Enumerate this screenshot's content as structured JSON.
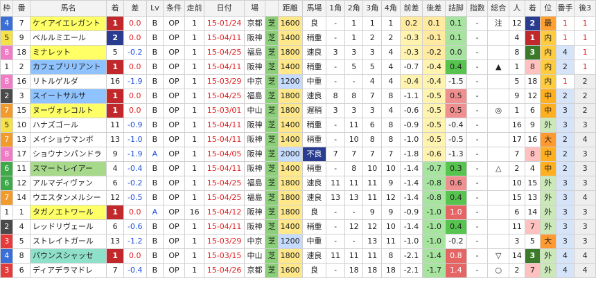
{
  "headers": [
    "枠",
    "番",
    "馬名",
    "着",
    "差",
    "Lv",
    "条件",
    "走前",
    "日付",
    "場",
    "",
    "距離",
    "馬場",
    "1角",
    "2角",
    "3角",
    "4角",
    "前差",
    "後差",
    "詰脚",
    "指数",
    "総合",
    "人",
    "着",
    "位",
    "番手",
    "後3"
  ],
  "rows": [
    {
      "gate": "4",
      "num": "7",
      "name": "ケイアイエレガント",
      "namecls": "nm-yellow",
      "fin": "1",
      "diff": "0.0",
      "lv": "B",
      "cls": "OP",
      "prev": "1",
      "date": "15-01/24",
      "track": "京都",
      "surf": "芝",
      "dist": "1600",
      "distcls": "dist",
      "cond": "良",
      "c1": "-",
      "c2": "1",
      "c3": "1",
      "c4": "1",
      "front": "0.2",
      "back": "0.1",
      "close": "0.1",
      "idx": "-",
      "total": "注",
      "pop": "12",
      "pfin": "2",
      "pos": "最",
      "ban": "1",
      "l3": "1"
    },
    {
      "gate": "5",
      "num": "9",
      "name": "ベルルミエール",
      "namecls": "",
      "fin": "2",
      "diff": "0.0",
      "lv": "B",
      "cls": "OP",
      "prev": "1",
      "date": "15-04/11",
      "track": "阪神",
      "surf": "芝",
      "dist": "1400",
      "distcls": "dist",
      "cond": "稍重",
      "c1": "-",
      "c2": "1",
      "c3": "2",
      "c4": "2",
      "front": "-0.3",
      "back": "-0.1",
      "close": "0.1",
      "idx": "-",
      "total": "",
      "pop": "4",
      "pfin": "1",
      "pos": "内",
      "ban": "1",
      "l3": "1"
    },
    {
      "gate": "8",
      "num": "18",
      "name": "ミナレット",
      "namecls": "nm-yellow",
      "fin": "5",
      "diff": "-0.2",
      "lv": "B",
      "cls": "OP",
      "prev": "1",
      "date": "15-04/25",
      "track": "福島",
      "surf": "芝",
      "dist": "1800",
      "distcls": "dist",
      "cond": "速良",
      "c1": "3",
      "c2": "3",
      "c3": "3",
      "c4": "4",
      "front": "-0.3",
      "back": "-0.2",
      "close": "0.0",
      "idx": "-",
      "total": "",
      "pop": "8",
      "pfin": "3",
      "pos": "内",
      "ban": "4",
      "l3": "1"
    },
    {
      "gate": "1",
      "num": "2",
      "name": "カフェブリリアント",
      "namecls": "nm-blue",
      "fin": "1",
      "diff": "0.0",
      "lv": "B",
      "cls": "OP",
      "prev": "1",
      "date": "15-04/11",
      "track": "阪神",
      "surf": "芝",
      "dist": "1400",
      "distcls": "dist",
      "cond": "稍重",
      "c1": "-",
      "c2": "5",
      "c3": "5",
      "c4": "4",
      "front": "-0.7",
      "back": "-0.4",
      "close": "0.4",
      "idx": "-",
      "total": "▲",
      "pop": "1",
      "pfin": "8",
      "pos": "内",
      "ban": "2",
      "l3": "1"
    },
    {
      "gate": "8",
      "num": "16",
      "name": "リトルゲルダ",
      "namecls": "",
      "fin": "16",
      "diff": "-1.9",
      "lv": "B",
      "cls": "OP",
      "prev": "1",
      "date": "15-03/29",
      "track": "中京",
      "surf": "芝",
      "dist": "1200",
      "distcls": "dist-blue",
      "cond": "中重",
      "c1": "-",
      "c2": "-",
      "c3": "4",
      "c4": "4",
      "front": "-0.4",
      "back": "-0.4",
      "close": "-1.5",
      "idx": "-",
      "total": "",
      "pop": "5",
      "pfin": "18",
      "pos": "内",
      "ban": "1",
      "l3": "2"
    },
    {
      "gate": "2",
      "num": "3",
      "name": "スイートサルサ",
      "namecls": "nm-blue",
      "fin": "1",
      "diff": "0.0",
      "lv": "B",
      "cls": "OP",
      "prev": "1",
      "date": "15-04/25",
      "track": "福島",
      "surf": "芝",
      "dist": "1800",
      "distcls": "dist",
      "cond": "速良",
      "c1": "8",
      "c2": "8",
      "c3": "7",
      "c4": "8",
      "front": "-1.1",
      "back": "-0.5",
      "close": "0.5",
      "idx": "-",
      "total": "",
      "pop": "9",
      "pfin": "12",
      "pos": "中",
      "ban": "2",
      "l3": "2"
    },
    {
      "gate": "7",
      "num": "15",
      "name": "ヌーヴォレコルト",
      "namecls": "nm-yellow",
      "fin": "1",
      "diff": "0.0",
      "lv": "B",
      "cls": "OP",
      "prev": "1",
      "date": "15-03/01",
      "track": "中山",
      "surf": "芝",
      "dist": "1800",
      "distcls": "dist",
      "cond": "遅稍",
      "c1": "3",
      "c2": "3",
      "c3": "3",
      "c4": "4",
      "front": "-0.6",
      "back": "-0.5",
      "close": "0.5",
      "idx": "-",
      "total": "◎",
      "pop": "1",
      "pfin": "6",
      "pos": "中",
      "ban": "3",
      "l3": "2"
    },
    {
      "gate": "5",
      "num": "10",
      "name": "ハナズゴール",
      "namecls": "",
      "fin": "11",
      "diff": "-0.9",
      "lv": "B",
      "cls": "OP",
      "prev": "1",
      "date": "15-04/11",
      "track": "阪神",
      "surf": "芝",
      "dist": "1400",
      "distcls": "dist",
      "cond": "稍重",
      "c1": "-",
      "c2": "11",
      "c3": "6",
      "c4": "8",
      "front": "-0.9",
      "back": "-0.5",
      "close": "-0.4",
      "idx": "-",
      "total": "",
      "pop": "16",
      "pfin": "9",
      "pos": "外",
      "ban": "3",
      "l3": "3"
    },
    {
      "gate": "7",
      "num": "13",
      "name": "メイショウマンボ",
      "namecls": "",
      "fin": "13",
      "diff": "-1.0",
      "lv": "B",
      "cls": "OP",
      "prev": "1",
      "date": "15-04/11",
      "track": "阪神",
      "surf": "芝",
      "dist": "1400",
      "distcls": "dist",
      "cond": "稍重",
      "c1": "-",
      "c2": "10",
      "c3": "8",
      "c4": "8",
      "front": "-1.0",
      "back": "-0.5",
      "close": "-0.5",
      "idx": "-",
      "total": "",
      "pop": "17",
      "pfin": "16",
      "pos": "大",
      "ban": "2",
      "l3": "4"
    },
    {
      "gate": "8",
      "num": "17",
      "name": "ショウナンパンドラ",
      "namecls": "",
      "fin": "9",
      "diff": "-1.9",
      "lv": "A",
      "cls": "OP",
      "prev": "1",
      "date": "15-04/05",
      "track": "阪神",
      "surf": "芝",
      "dist": "2000",
      "distcls": "dist-blue",
      "cond": "不良",
      "c1": "7",
      "c2": "7",
      "c3": "7",
      "c4": "7",
      "front": "-1.8",
      "back": "-0.6",
      "close": "-1.3",
      "idx": "-",
      "total": "",
      "pop": "7",
      "pfin": "8",
      "pos": "中",
      "ban": "2",
      "l3": "3"
    },
    {
      "gate": "6",
      "num": "11",
      "name": "スマートレイアー",
      "namecls": "nm-green",
      "fin": "4",
      "diff": "-0.4",
      "lv": "B",
      "cls": "OP",
      "prev": "1",
      "date": "15-04/11",
      "track": "阪神",
      "surf": "芝",
      "dist": "1400",
      "distcls": "dist",
      "cond": "稍重",
      "c1": "-",
      "c2": "8",
      "c3": "10",
      "c4": "10",
      "front": "-1.4",
      "back": "-0.7",
      "close": "0.3",
      "idx": "-",
      "total": "△",
      "pop": "2",
      "pfin": "4",
      "pos": "中",
      "ban": "2",
      "l3": "3"
    },
    {
      "gate": "6",
      "num": "12",
      "name": "アルマディヴァン",
      "namecls": "",
      "fin": "6",
      "diff": "-0.2",
      "lv": "B",
      "cls": "OP",
      "prev": "1",
      "date": "15-04/25",
      "track": "福島",
      "surf": "芝",
      "dist": "1800",
      "distcls": "dist",
      "cond": "速良",
      "c1": "11",
      "c2": "11",
      "c3": "11",
      "c4": "9",
      "front": "-1.4",
      "back": "-0.8",
      "close": "0.6",
      "idx": "-",
      "total": "",
      "pop": "10",
      "pfin": "15",
      "pos": "外",
      "ban": "3",
      "l3": "3"
    },
    {
      "gate": "7",
      "num": "14",
      "name": "ウエスタンメルシー",
      "namecls": "",
      "fin": "12",
      "diff": "-0.5",
      "lv": "B",
      "cls": "OP",
      "prev": "1",
      "date": "15-04/25",
      "track": "福島",
      "surf": "芝",
      "dist": "1800",
      "distcls": "dist",
      "cond": "速良",
      "c1": "13",
      "c2": "13",
      "c3": "11",
      "c4": "12",
      "front": "-1.4",
      "back": "-0.8",
      "close": "0.4",
      "idx": "-",
      "total": "",
      "pop": "15",
      "pfin": "13",
      "pos": "外",
      "ban": "3",
      "l3": "4"
    },
    {
      "gate": "1",
      "num": "1",
      "name": "タガノエトワール",
      "namecls": "nm-yellow",
      "fin": "1",
      "diff": "0.0",
      "lv": "A",
      "cls": "OP",
      "prev": "16",
      "date": "15-04/12",
      "track": "阪神",
      "surf": "芝",
      "dist": "1800",
      "distcls": "dist",
      "cond": "良",
      "c1": "-",
      "c2": "-",
      "c3": "9",
      "c4": "9",
      "front": "-0.9",
      "back": "-1.0",
      "close": "1.0",
      "idx": "-",
      "total": "",
      "pop": "6",
      "pfin": "14",
      "pos": "外",
      "ban": "3",
      "l3": "3"
    },
    {
      "gate": "2",
      "num": "4",
      "name": "レッドリヴェール",
      "namecls": "",
      "fin": "6",
      "diff": "-0.6",
      "lv": "B",
      "cls": "OP",
      "prev": "1",
      "date": "15-04/11",
      "track": "阪神",
      "surf": "芝",
      "dist": "1400",
      "distcls": "dist",
      "cond": "稍重",
      "c1": "-",
      "c2": "12",
      "c3": "12",
      "c4": "10",
      "front": "-1.4",
      "back": "-1.0",
      "close": "0.4",
      "idx": "-",
      "total": "",
      "pop": "11",
      "pfin": "7",
      "pos": "外",
      "ban": "3",
      "l3": "3"
    },
    {
      "gate": "3",
      "num": "5",
      "name": "ストレイトガール",
      "namecls": "",
      "fin": "13",
      "diff": "-1.2",
      "lv": "B",
      "cls": "OP",
      "prev": "1",
      "date": "15-03/29",
      "track": "中京",
      "surf": "芝",
      "dist": "1200",
      "distcls": "dist-blue",
      "cond": "中重",
      "c1": "-",
      "c2": "-",
      "c3": "13",
      "c4": "11",
      "front": "-1.0",
      "back": "-1.0",
      "close": "-0.2",
      "idx": "-",
      "total": "",
      "pop": "3",
      "pfin": "5",
      "pos": "大",
      "ban": "3",
      "l3": "3"
    },
    {
      "gate": "4",
      "num": "8",
      "name": "パウンスシャッセ",
      "namecls": "nm-teal",
      "fin": "1",
      "diff": "0.0",
      "lv": "B",
      "cls": "OP",
      "prev": "1",
      "date": "15-03/15",
      "track": "中山",
      "surf": "芝",
      "dist": "1800",
      "distcls": "dist",
      "cond": "速良",
      "c1": "11",
      "c2": "11",
      "c3": "11",
      "c4": "8",
      "front": "-2.1",
      "back": "-1.4",
      "close": "0.8",
      "idx": "-",
      "total": "▽",
      "pop": "14",
      "pfin": "3",
      "pos": "外",
      "ban": "4",
      "l3": "4"
    },
    {
      "gate": "3",
      "num": "6",
      "name": "ディアデラマドレ",
      "namecls": "",
      "fin": "7",
      "diff": "-0.4",
      "lv": "B",
      "cls": "OP",
      "prev": "1",
      "date": "15-04/26",
      "track": "京都",
      "surf": "芝",
      "dist": "1600",
      "distcls": "dist",
      "cond": "良",
      "c1": "-",
      "c2": "18",
      "c3": "18",
      "c4": "18",
      "front": "-2.1",
      "back": "-1.7",
      "close": "1.4",
      "idx": "-",
      "total": "○",
      "pop": "2",
      "pfin": "7",
      "pos": "外",
      "ban": "4",
      "l3": "4"
    }
  ]
}
